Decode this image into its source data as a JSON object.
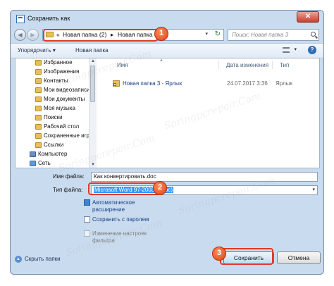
{
  "window": {
    "title": "Сохранить как",
    "close_label": "✕"
  },
  "navigation": {
    "back_icon": "back-arrow-icon",
    "forward_icon": "forward-arrow-icon",
    "breadcrumb_prefix": "«",
    "breadcrumb": [
      "Новая папка (2)",
      "Новая папка 3"
    ],
    "separator": "▸",
    "dropdown": "▾",
    "refresh_icon": "↻",
    "search_placeholder": "Поиск: Новая папка 3"
  },
  "toolbar": {
    "organize_label": "Упорядочить ▾",
    "new_folder_label": "Новая папка",
    "view_dropdown": "▾",
    "help_label": "?"
  },
  "sidebar": {
    "items": [
      {
        "label": "Избранное",
        "icon": "star-icon"
      },
      {
        "label": "Изображения",
        "icon": "pictures-icon"
      },
      {
        "label": "Контакты",
        "icon": "contacts-icon"
      },
      {
        "label": "Мои видеозаписи",
        "icon": "videos-icon"
      },
      {
        "label": "Мои документы",
        "icon": "documents-icon"
      },
      {
        "label": "Моя музыка",
        "icon": "music-icon"
      },
      {
        "label": "Поиски",
        "icon": "searches-icon"
      },
      {
        "label": "Рабочий стол",
        "icon": "desktop-icon"
      },
      {
        "label": "Сохраненные игры",
        "icon": "games-icon"
      },
      {
        "label": "Ссылки",
        "icon": "links-icon"
      },
      {
        "label": "Компьютер",
        "icon": "computer-icon"
      },
      {
        "label": "Сеть",
        "icon": "network-icon"
      }
    ],
    "scroll_up": "▲",
    "scroll_down": "▼"
  },
  "filelist": {
    "columns": [
      "Имя",
      "Дата изменения",
      "Тип"
    ],
    "sort_indicator": "▲",
    "rows": [
      {
        "name": "Новая папка 3 - Ярлык",
        "date": "24.07.2017 3:36",
        "type": "Ярлык",
        "icon": "shortcut-folder-icon"
      }
    ]
  },
  "form": {
    "filename_label": "Имя файла:",
    "filename_value": "Как конвертировать.doc",
    "filetype_label": "Тип файла:",
    "filetype_value": "Microsoft Word 97-2003 (*.doc)",
    "filetype_tail": " (*.doc)",
    "filetype_dropdown": "▾",
    "options": [
      {
        "label_1": "Автоматическое",
        "label_2": "расширение",
        "checked": true,
        "enabled": true
      },
      {
        "label_1": "Сохранить с паролем",
        "label_2": "",
        "checked": false,
        "enabled": true
      },
      {
        "label_1": "Изменение настроек",
        "label_2": "фильтра",
        "checked": false,
        "enabled": false
      }
    ]
  },
  "footer": {
    "hide_folders_label": "Скрыть папки",
    "hide_icon": "▲",
    "save_label": "Сохранить",
    "cancel_label": "Отмена"
  },
  "callouts": [
    "1",
    "2",
    "3"
  ],
  "watermark": "Soringpcrepair.Com",
  "colors": {
    "accent_red": "#e03a2a",
    "dialog_bg": "#c9dcef",
    "link_blue": "#1b3e8a",
    "selection": "#3399ff"
  }
}
